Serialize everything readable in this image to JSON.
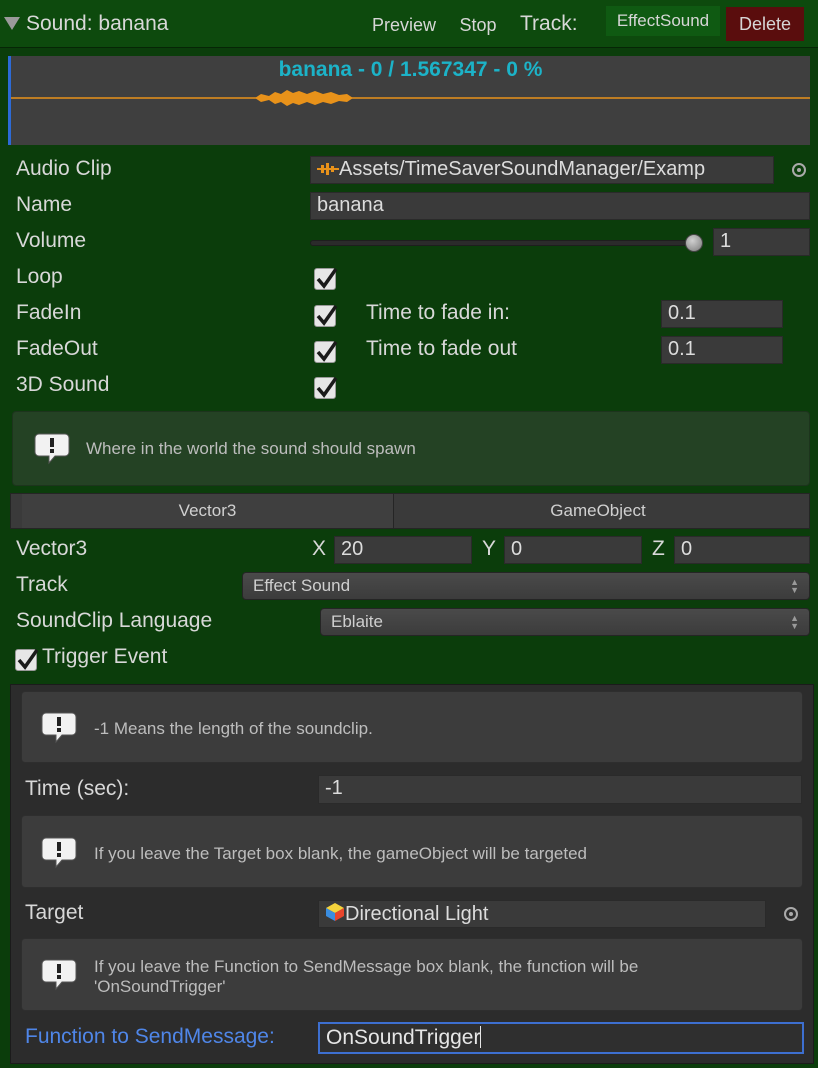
{
  "header": {
    "title": "Sound: banana",
    "preview_label": "Preview",
    "stop_label": "Stop",
    "track_label": "Track:",
    "track_value": "EffectSound",
    "delete_label": "Delete"
  },
  "waveform": {
    "caption": "banana - 0 / 1.567347 - 0 %",
    "caption_color": "#1cb3c8",
    "wave_color": "#e8921a"
  },
  "fields": {
    "audio_clip_label": "Audio Clip",
    "audio_clip_value": "Assets/TimeSaverSoundManager/Examp",
    "name_label": "Name",
    "name_value": "banana",
    "volume_label": "Volume",
    "volume_value": "1",
    "volume_fraction": 1.0,
    "loop_label": "Loop",
    "fadein_label": "FadeIn",
    "fadein_time_label": "Time to fade in:",
    "fadein_time_value": "0.1",
    "fadeout_label": "FadeOut",
    "fadeout_time_label": "Time to fade out",
    "fadeout_time_value": "0.1",
    "sound3d_label": "3D Sound",
    "spawn_help": "Where in the world the sound should spawn"
  },
  "spawn_tabs": [
    "Vector3",
    "GameObject"
  ],
  "vector3": {
    "label": "Vector3",
    "x_label": "X",
    "x_value": "20",
    "y_label": "Y",
    "y_value": "0",
    "z_label": "Z",
    "z_value": "0"
  },
  "track": {
    "label": "Track",
    "value": "Effect Sound"
  },
  "language": {
    "label": "SoundClip Language",
    "value": "Eblaite"
  },
  "trigger": {
    "label": "Trigger Event",
    "length_help": "-1 Means the length of the soundclip.",
    "time_label": "Time (sec):",
    "time_value": "-1",
    "target_help": "If you leave the Target box blank, the gameObject will be targeted",
    "target_label": "Target",
    "target_value": "Directional Light",
    "function_help_line1": "If you leave the Function to SendMessage box blank, the function will be",
    "function_help_line2": "'OnSoundTrigger'",
    "function_label": "Function to SendMessage:",
    "function_value": "OnSoundTrigger"
  },
  "colors": {
    "background": "#0b3d0b",
    "delete_bg": "#5a0d0d",
    "focus_label": "#4f86e8",
    "focus_border": "#3d6fd0"
  },
  "icons": [
    "foldout-triangle-icon",
    "checkmark-icon",
    "info-icon",
    "object-picker-icon",
    "audio-clip-icon",
    "gameobject-cube-icon",
    "dropdown-arrows-icon"
  ]
}
